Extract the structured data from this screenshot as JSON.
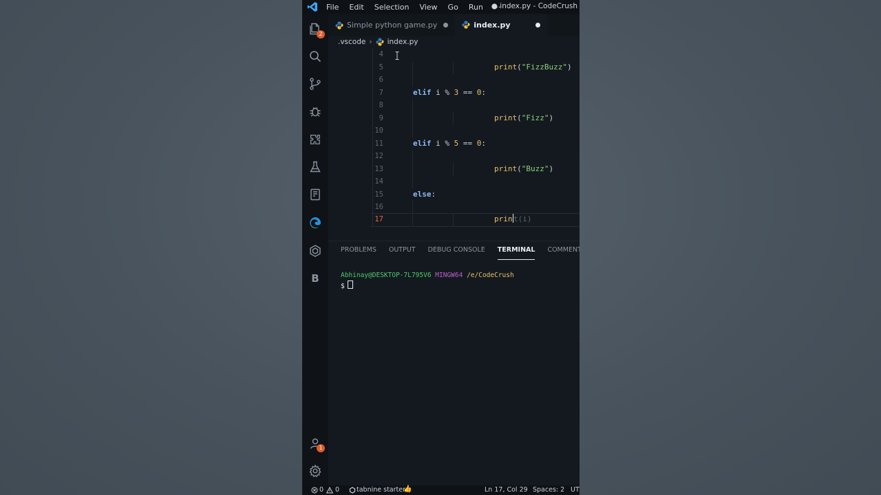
{
  "window": {
    "menu": [
      "File",
      "Edit",
      "Selection",
      "View",
      "Go",
      "Run",
      "···"
    ],
    "title": "● index.py - CodeCrush"
  },
  "activity_bar": {
    "items": [
      {
        "icon": "explorer-icon",
        "badge": "2"
      },
      {
        "icon": "search-icon"
      },
      {
        "icon": "source-control-icon"
      },
      {
        "icon": "debug-icon"
      },
      {
        "icon": "extensions-icon"
      },
      {
        "icon": "testing-icon"
      },
      {
        "icon": "remote-explorer-icon"
      },
      {
        "icon": "edge-icon"
      },
      {
        "icon": "docker-icon"
      },
      {
        "icon": "b-icon",
        "label": "B"
      }
    ],
    "bottom": [
      {
        "icon": "account-icon",
        "badge": "1"
      },
      {
        "icon": "gear-icon"
      }
    ]
  },
  "tabs": [
    {
      "label": "Simple python game.py",
      "modified": true,
      "active": false
    },
    {
      "label": "index.py",
      "modified": true,
      "active": true
    }
  ],
  "breadcrumb": {
    "folder": ".vscode",
    "file": "index.py"
  },
  "editor": {
    "current_line": "17",
    "lines": [
      {
        "num": "4"
      },
      {
        "num": "5",
        "indent": 2,
        "print": "print",
        "arg": "\"FizzBuzz\"",
        "close": ")"
      },
      {
        "num": "6"
      },
      {
        "num": "7",
        "indent": 1,
        "kw": "elif",
        "text": " i % ",
        "n": "3",
        "rest": " == ",
        "n2": "0",
        "end": ":"
      },
      {
        "num": "8"
      },
      {
        "num": "9",
        "indent": 2,
        "print": "print",
        "arg": "\"Fizz\"",
        "close": ")"
      },
      {
        "num": "10"
      },
      {
        "num": "11",
        "indent": 1,
        "kw": "elif",
        "text": " i % ",
        "n": "5",
        "rest": " == ",
        "n2": "0",
        "end": ":"
      },
      {
        "num": "12"
      },
      {
        "num": "13",
        "indent": 2,
        "print": "print",
        "arg": "\"Buzz\"",
        "close": ")"
      },
      {
        "num": "14"
      },
      {
        "num": "15",
        "indent": 1,
        "kw": "else",
        "end": ":"
      },
      {
        "num": "16"
      },
      {
        "num": "17",
        "indent": 2,
        "typed": "prin",
        "ghost": "t(i)"
      }
    ]
  },
  "panel": {
    "tabs": [
      "PROBLEMS",
      "OUTPUT",
      "DEBUG CONSOLE",
      "TERMINAL",
      "COMMENTS"
    ],
    "active_tab": "TERMINAL",
    "terminal": {
      "user": "Abhinay@DESKTOP-7L795V6",
      "env": "MINGW64",
      "path": "/e/CodeCrush",
      "prompt": "$"
    }
  },
  "status_bar": {
    "errors": "0",
    "warnings": "0",
    "tabnine": "tabnine starter",
    "position": "Ln 17, Col 29",
    "spaces": "Spaces: 2",
    "encoding": "UT"
  },
  "colors": {
    "background": "#14191f",
    "keyword": "#8fb8f5",
    "function": "#e6c06b",
    "string": "#8ccf7e",
    "current_line_number": "#e8663d",
    "badge": "#e05a2a"
  }
}
